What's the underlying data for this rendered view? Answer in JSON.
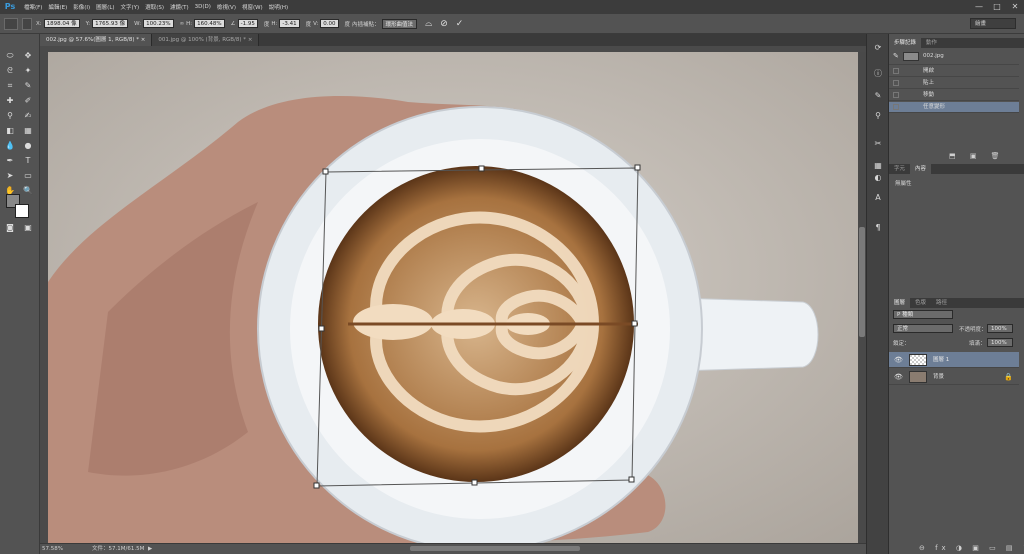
{
  "app": {
    "logo": "Ps"
  },
  "menu": [
    "檔案(F)",
    "編輯(E)",
    "影像(I)",
    "圖層(L)",
    "文字(Y)",
    "選取(S)",
    "濾鏡(T)",
    "3D(D)",
    "檢視(V)",
    "視窗(W)",
    "說明(H)"
  ],
  "window_controls": {
    "minimize": "—",
    "maximize": "□",
    "close": "✕"
  },
  "options": {
    "x_label": "X:",
    "x_value": "1898.04 像",
    "y_label": "Y:",
    "y_value": "1765.93 像",
    "w_label": "W:",
    "w_value": "100.23%",
    "h_label": "H:",
    "h_value": "160.48%",
    "angle_label": "∠",
    "angle_value": "-1.95",
    "angle_unit": "度",
    "hskew_label": "H:",
    "hskew_value": "-3.41",
    "hskew_unit": "度",
    "vskew_label": "V:",
    "vskew_value": "0.00",
    "vskew_unit": "度",
    "interp_label": "內插補點：",
    "interp_value": "環形曲值法",
    "cancel_glyph": "⊘",
    "commit_glyph": "✓",
    "workspace": "繪畫"
  },
  "tabs": [
    {
      "label": "002.jpg @ 57.6%(圖層 1, RGB/8) *",
      "close": "×",
      "active": true
    },
    {
      "label": "001.jpg @ 100% (背景, RGB/8) *",
      "close": "×",
      "active": false
    }
  ],
  "status": {
    "zoom": "57.58%",
    "doc": "文件：57.1M/61.5M",
    "arrow": "▶"
  },
  "history": {
    "tabs": [
      "步驟記錄",
      "動作"
    ],
    "snapshot": "002.jpg",
    "items": [
      "開啟",
      "貼上",
      "移動",
      "任意變形"
    ],
    "active_index": 3,
    "bottom_icons": "⬒ ▣ 🗑"
  },
  "properties": {
    "tabs": [
      "字元",
      "內容"
    ],
    "empty_text": "無屬性"
  },
  "layers": {
    "tabs": [
      "圖層",
      "色版",
      "路徑"
    ],
    "kind": "P 種類",
    "blend_mode": "正常",
    "opacity_label": "不透明度：",
    "opacity_value": "100%",
    "lock_label": "鎖定：",
    "fill_label": "填滿：",
    "fill_value": "100%",
    "items": [
      {
        "name": "圖層 1",
        "active": true
      },
      {
        "name": "背景",
        "active": false,
        "locked": true
      }
    ],
    "bottom_icons": "⊖ fx ◑ ▣ ▭ ▤ 🗑"
  },
  "colors": {
    "accent": "#3a9bdc",
    "selected_row": "#6d7e96",
    "bg": "#535353"
  }
}
